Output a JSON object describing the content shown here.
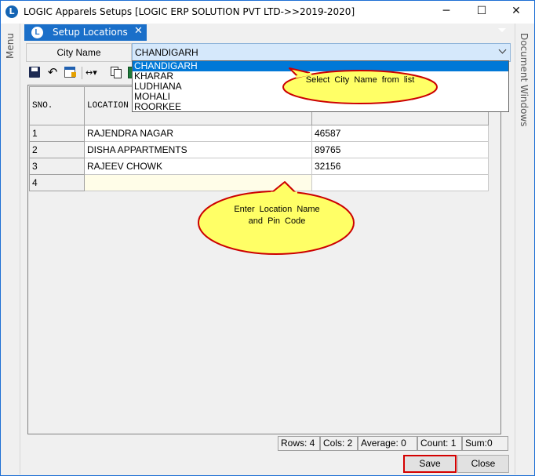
{
  "window": {
    "title": "LOGIC Apparels Setups  [LOGIC ERP SOLUTION PVT LTD->>2019-2020]",
    "minimize_glyph": "─",
    "maximize_glyph": "☐",
    "close_glyph": "✕",
    "logo_letter": "L"
  },
  "side_panels": {
    "left_label": "Menu",
    "right_label": "Document Windows"
  },
  "tab": {
    "label": "Setup Locations",
    "close_glyph": "✕"
  },
  "form": {
    "city_label": "City Name",
    "city_value": "CHANDIGARH",
    "city_options": [
      "CHANDIGARH",
      "KHARAR",
      "LUDHIANA",
      "MOHALI",
      "ROORKEE"
    ],
    "selected_option": "CHANDIGARH"
  },
  "toolbar": {
    "icons": [
      "save-icon",
      "undo-icon",
      "calendar-icon",
      "resize-columns-icon",
      "copy-icon",
      "excel-icon"
    ],
    "undo_glyph": "↶",
    "resize_glyph": "↔▾"
  },
  "grid": {
    "columns": [
      "SNO.",
      "LOCATION",
      ""
    ],
    "rows": [
      {
        "sno": "1",
        "location": "RAJENDRA NAGAR",
        "pin": "46587"
      },
      {
        "sno": "2",
        "location": "DISHA APPARTMENTS",
        "pin": "89765"
      },
      {
        "sno": "3",
        "location": "RAJEEV CHOWK",
        "pin": "32156"
      },
      {
        "sno": "4",
        "location": "",
        "pin": ""
      }
    ]
  },
  "callouts": {
    "select_city": "Select City Name from list",
    "enter_location": "Enter Location Name and Pin Code",
    "fill_color": "#ffff66",
    "border_color": "#cc0000"
  },
  "status": {
    "rows": "Rows: 4",
    "cols": "Cols: 2",
    "average": "Average: 0",
    "count": "Count: 1",
    "sum": "Sum:0"
  },
  "buttons": {
    "save": "Save",
    "close": "Close"
  }
}
